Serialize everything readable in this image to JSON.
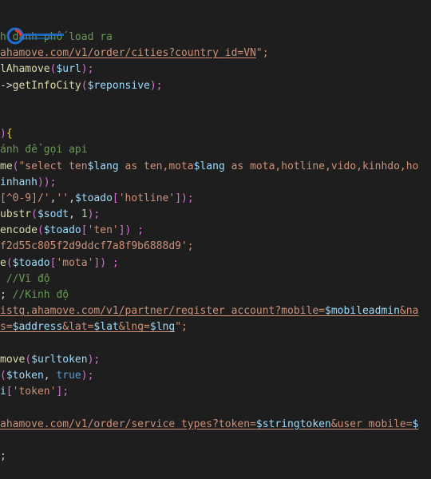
{
  "logo": {
    "text": "",
    "colors": {
      "primary": "#1f6fd6",
      "accent": "#e8392b"
    }
  },
  "code_lines": [
    [
      {
        "t": "h danh phố load ra",
        "c": "cmt"
      }
    ],
    [
      {
        "t": "ahamove.com/v1/order/cities?country_id=VN",
        "c": "link"
      },
      {
        "t": "\";",
        "c": "str"
      }
    ],
    [
      {
        "t": "lAhamove",
        "c": "fn"
      },
      {
        "t": "(",
        "c": "paren"
      },
      {
        "t": "$url",
        "c": "var"
      },
      {
        "t": ");",
        "c": "paren"
      }
    ],
    [
      {
        "t": "->",
        "c": "punc"
      },
      {
        "t": "getInfoCity",
        "c": "fn"
      },
      {
        "t": "(",
        "c": "paren"
      },
      {
        "t": "$reponsive",
        "c": "var"
      },
      {
        "t": ");",
        "c": "paren"
      }
    ],
    [],
    [],
    [
      {
        "t": ")",
        "c": "paren"
      },
      {
        "t": "{",
        "c": "brace"
      }
    ],
    [
      {
        "t": "ánh để gọi api",
        "c": "cmt"
      }
    ],
    [
      {
        "t": "me",
        "c": "fn"
      },
      {
        "t": "(",
        "c": "paren"
      },
      {
        "t": "\"select ten",
        "c": "str"
      },
      {
        "t": "$lang",
        "c": "var"
      },
      {
        "t": " as ten,mota",
        "c": "str"
      },
      {
        "t": "$lang",
        "c": "var"
      },
      {
        "t": " as mota,hotline,vido,kinhdo,ho",
        "c": "str"
      }
    ],
    [
      {
        "t": "inhanh",
        "c": "var"
      },
      {
        "t": "));",
        "c": "paren"
      }
    ],
    [
      {
        "t": "[^0-9]/'",
        "c": "str"
      },
      {
        "t": ",",
        "c": "punc"
      },
      {
        "t": "''",
        "c": "str"
      },
      {
        "t": ",",
        "c": "punc"
      },
      {
        "t": "$toado",
        "c": "var"
      },
      {
        "t": "[",
        "c": "paren"
      },
      {
        "t": "'hotline'",
        "c": "str"
      },
      {
        "t": "]);",
        "c": "paren"
      }
    ],
    [
      {
        "t": "ubstr",
        "c": "fn"
      },
      {
        "t": "(",
        "c": "paren"
      },
      {
        "t": "$sodt",
        "c": "var"
      },
      {
        "t": ", ",
        "c": "punc"
      },
      {
        "t": "1",
        "c": "num"
      },
      {
        "t": ");",
        "c": "paren"
      }
    ],
    [
      {
        "t": "encode",
        "c": "fn"
      },
      {
        "t": "(",
        "c": "paren"
      },
      {
        "t": "$toado",
        "c": "var"
      },
      {
        "t": "[",
        "c": "paren"
      },
      {
        "t": "'ten'",
        "c": "str"
      },
      {
        "t": "]) ;",
        "c": "paren"
      }
    ],
    [
      {
        "t": "f2d55c805f2d9ddcf7a8f9b6888d9';",
        "c": "str"
      }
    ],
    [
      {
        "t": "e",
        "c": "fn"
      },
      {
        "t": "(",
        "c": "paren"
      },
      {
        "t": "$toado",
        "c": "var"
      },
      {
        "t": "[",
        "c": "paren"
      },
      {
        "t": "'mota'",
        "c": "str"
      },
      {
        "t": "]) ;",
        "c": "paren"
      }
    ],
    [
      {
        "t": " //Vĩ độ",
        "c": "cmt"
      }
    ],
    [
      {
        "t": "; ",
        "c": "punc"
      },
      {
        "t": "//Kinh độ",
        "c": "cmt"
      }
    ],
    [
      {
        "t": "istg.ahamove.com/v1/partner/register_account?mobile=",
        "c": "link"
      },
      {
        "t": "$mobileadmin",
        "c": "linkvar"
      },
      {
        "t": "&na",
        "c": "link"
      }
    ],
    [
      {
        "t": "s=",
        "c": "link"
      },
      {
        "t": "$address",
        "c": "linkvar"
      },
      {
        "t": "&lat=",
        "c": "link"
      },
      {
        "t": "$lat",
        "c": "linkvar"
      },
      {
        "t": "&lng=",
        "c": "link"
      },
      {
        "t": "$lng",
        "c": "linkvar"
      },
      {
        "t": "\";",
        "c": "str"
      }
    ],
    [],
    [
      {
        "t": "move",
        "c": "fn"
      },
      {
        "t": "(",
        "c": "paren"
      },
      {
        "t": "$urltoken",
        "c": "var"
      },
      {
        "t": ");",
        "c": "paren"
      }
    ],
    [
      {
        "t": "(",
        "c": "paren"
      },
      {
        "t": "$token",
        "c": "var"
      },
      {
        "t": ", ",
        "c": "punc"
      },
      {
        "t": "true",
        "c": "kw"
      },
      {
        "t": ");",
        "c": "paren"
      }
    ],
    [
      {
        "t": "i",
        "c": "var"
      },
      {
        "t": "[",
        "c": "paren"
      },
      {
        "t": "'token'",
        "c": "str"
      },
      {
        "t": "];",
        "c": "paren"
      }
    ],
    [],
    [
      {
        "t": "ahamove.com/v1/order/service_types?token=",
        "c": "link"
      },
      {
        "t": "$stringtoken",
        "c": "linkvar"
      },
      {
        "t": "&user_mobile=",
        "c": "link"
      },
      {
        "t": "$",
        "c": "linkvar"
      }
    ],
    [],
    [
      {
        "t": ";",
        "c": "punc"
      }
    ]
  ]
}
